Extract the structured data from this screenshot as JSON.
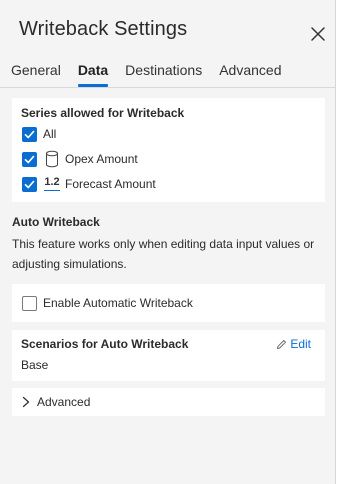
{
  "panel": {
    "title": "Writeback Settings",
    "close_icon": "close-icon"
  },
  "tabs": [
    {
      "label": "General",
      "active": false
    },
    {
      "label": "Data",
      "active": true
    },
    {
      "label": "Destinations",
      "active": false
    },
    {
      "label": "Advanced",
      "active": false
    }
  ],
  "series_section": {
    "label": "Series allowed for Writeback",
    "items": [
      {
        "label": "All",
        "checked": true,
        "icon": ""
      },
      {
        "label": "Opex Amount",
        "checked": true,
        "icon": "cylinder-icon"
      },
      {
        "label": "Forecast Amount",
        "checked": true,
        "icon": "decimal-number-icon",
        "icon_text": "1.2"
      }
    ]
  },
  "auto_writeback": {
    "heading": "Auto Writeback",
    "description": "This feature works only when editing data input values or adjusting simulations.",
    "enable_label": "Enable Automatic Writeback",
    "enabled": false
  },
  "scenarios": {
    "label": "Scenarios for Auto Writeback",
    "edit_label": "Edit",
    "value": "Base"
  },
  "advanced": {
    "label": "Advanced"
  },
  "colors": {
    "accent": "#0a6ed1",
    "panel_bg": "#f4f4f4",
    "card_bg": "#ffffff"
  }
}
